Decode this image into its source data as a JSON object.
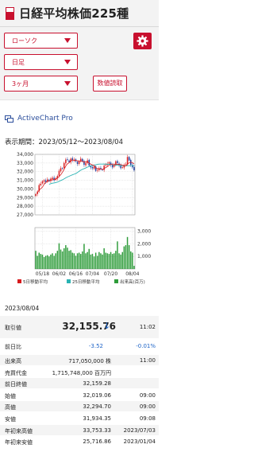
{
  "header": {
    "title": "日経平均株価225種"
  },
  "controls": {
    "chart_type": "ローソク",
    "interval": "日足",
    "range": "3ヶ月",
    "read_values_label": "数値読取"
  },
  "activechart": {
    "label": "ActiveChart Pro"
  },
  "period": {
    "text": "表示期間：2023/05/12〜2023/08/04"
  },
  "chart_data": {
    "type": "candlestick",
    "x_tick_labels": [
      "05/18",
      "06/02",
      "06/16",
      "07/04",
      "07/20",
      "08/04"
    ],
    "price_axis": {
      "tick_labels": [
        "34,000",
        "33,000",
        "32,000",
        "31,000",
        "30,000",
        "29,000",
        "28,000",
        "27,000"
      ],
      "ylim": [
        27000,
        34000
      ]
    },
    "volume_axis": {
      "tick_labels": [
        "3,000",
        "2,000",
        "1,000"
      ],
      "ylim": [
        0,
        3300
      ]
    },
    "candles_close": [
      29400,
      29700,
      30450,
      30600,
      30900,
      31000,
      30800,
      31100,
      30900,
      31200,
      31300,
      31000,
      31250,
      31500,
      32100,
      32400,
      32350,
      33000,
      33400,
      33350,
      33100,
      33500,
      33300,
      33400,
      33200,
      32900,
      33150,
      33500,
      33200,
      32800,
      33000,
      33300,
      32700,
      32500,
      32400,
      32600,
      32100,
      32200,
      32400,
      32300,
      32200,
      32700,
      32800,
      32900,
      33100,
      32800,
      32500,
      32750,
      33200,
      33000,
      32700,
      32400,
      32500,
      32800,
      32900,
      33700,
      33300,
      32800,
      32500,
      32159
    ],
    "volume": [
      1450,
      1050,
      1300,
      1200,
      1150,
      950,
      1050,
      1100,
      1000,
      1150,
      1250,
      1050,
      1250,
      1450,
      2050,
      1550,
      1400,
      1650,
      1900,
      1700,
      1450,
      1500,
      1300,
      1250,
      1050,
      1250,
      1300,
      1200,
      1400,
      2000,
      1250,
      1350,
      1600,
      1150,
      1200,
      1000,
      1300,
      1050,
      1350,
      1250,
      1150,
      1650,
      1300,
      1250,
      1200,
      1350,
      1200,
      1250,
      1450,
      2200,
      1250,
      1150,
      1350,
      1800,
      1900,
      2550,
      1900,
      1400,
      1300,
      250
    ],
    "legend": [
      "5日移動平均",
      "25日移動平均",
      "出来高(百万)"
    ],
    "colors": {
      "up": "#d7191c",
      "down": "#1a3a9c",
      "ma5": "#d7191c",
      "ma25": "#2ab3b3",
      "volume": "#2e9c3a",
      "grid": "#cccccc"
    }
  },
  "quote": {
    "date": "2023/08/04",
    "price_label": "取引値",
    "price": "32,155.76",
    "direction_arrow": "↓",
    "price_time": "11:02",
    "change_label": "前日比",
    "change": "-3.52",
    "change_pct": "-0.01%",
    "rows": [
      {
        "label": "出来高",
        "value": "717,050,000 株",
        "sub": "11:00"
      },
      {
        "label": "売買代金",
        "value": "1,715,748,000 百万円",
        "sub": ""
      },
      {
        "label": "前日終値",
        "value": "32,159.28",
        "sub": ""
      },
      {
        "label": "始値",
        "value": "32,019.06",
        "sub": "09:00"
      },
      {
        "label": "高値",
        "value": "32,294.70",
        "sub": "09:00"
      },
      {
        "label": "安値",
        "value": "31,934.35",
        "sub": "09:08"
      },
      {
        "label": "年初来高値",
        "value": "33,753.33",
        "sub": "2023/07/03"
      },
      {
        "label": "年初来安値",
        "value": "25,716.86",
        "sub": "2023/01/04"
      }
    ]
  }
}
